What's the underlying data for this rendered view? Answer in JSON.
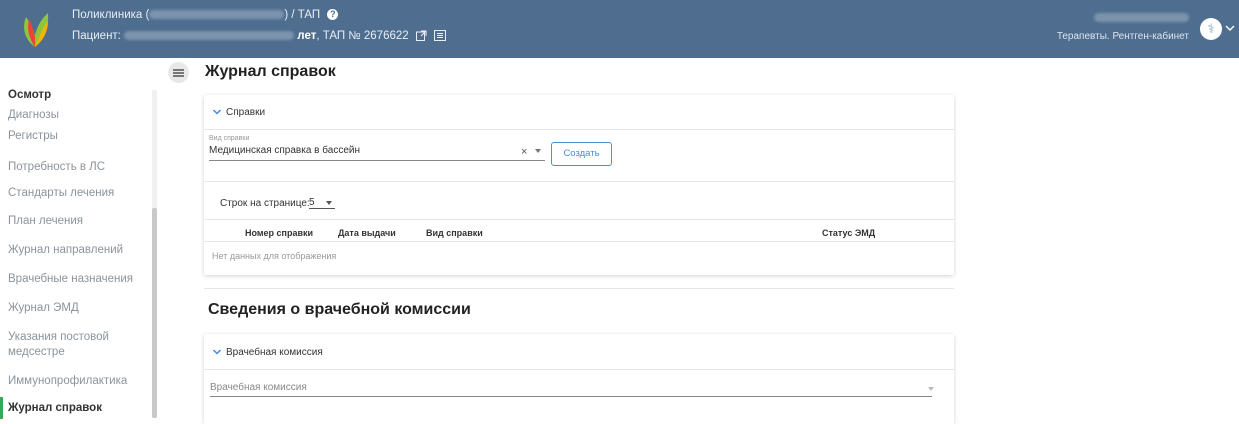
{
  "header": {
    "clinic_label": "Поликлиника (",
    "clinic_suffix": ") / ТАП",
    "patient_label": "Пациент:",
    "age_suffix": "лет",
    "tap_text": ", ТАП № 2676622",
    "user_role": "Терапевты. Рентген-кабинет"
  },
  "sidebar": {
    "items": [
      {
        "label": "Осмотр"
      },
      {
        "label": "Диагнозы"
      },
      {
        "label": "Регистры"
      },
      {
        "label": "Потребность в ЛС"
      },
      {
        "label": "Стандарты лечения"
      },
      {
        "label": "План лечения"
      },
      {
        "label": "Журнал направлений"
      },
      {
        "label": "Врачебные назначения"
      },
      {
        "label": "Журнал ЭМД"
      },
      {
        "label": "Указания постовой медсестре"
      },
      {
        "label": "Иммунопрофилактика"
      },
      {
        "label": "Журнал справок"
      }
    ]
  },
  "page": {
    "title": "Журнал справок"
  },
  "spravki": {
    "section_title": "Справки",
    "type_field": {
      "label": "Вид справки",
      "value": "Медицинская справка в бассейн",
      "clear_glyph": "×"
    },
    "create_label": "Создать",
    "rows_per_page_label": "Строк на странице:",
    "rows_per_page_value": "5",
    "columns": [
      "Номер справки",
      "Дата выдачи",
      "Вид справки",
      "Статус ЭМД"
    ],
    "no_data": "Нет данных для отображения"
  },
  "commission": {
    "title": "Сведения о врачебной комиссии",
    "section_title": "Врачебная комиссия",
    "field_placeholder": "Врачебная комиссия"
  },
  "colors": {
    "header_bg": "#4f6e8f",
    "accent_green": "#3aa757",
    "link_blue": "#4a8cd0"
  }
}
